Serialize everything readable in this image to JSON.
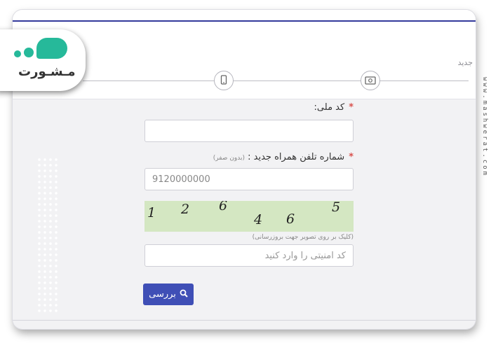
{
  "steps": {
    "label": "جدید",
    "items": [
      {
        "icon": "money-icon"
      },
      {
        "icon": "mobile-phone-icon"
      },
      {
        "icon": "step-circle-partial"
      }
    ]
  },
  "logo": {
    "text": "مـشـورت",
    "accent": "#26b99a"
  },
  "watermark": {
    "text": "www.mashwerat.com"
  },
  "form": {
    "national_code": {
      "label": "کد ملی:",
      "required_mark": "*",
      "value": ""
    },
    "phone": {
      "label": "شماره تلفن همراه جدید :",
      "hint": "(بدون صفر)",
      "required_mark": "*",
      "value": "9120000000"
    },
    "captcha": {
      "digits": [
        "1",
        "2",
        "6",
        "4",
        "6",
        "5"
      ],
      "hint": "(کلیک بر روی تصویر جهت بروزرسانی)"
    },
    "security_code": {
      "placeholder": "کد امنیتی را وارد کنید"
    },
    "submit": {
      "label": "بررسی",
      "icon": "search-icon"
    }
  },
  "colors": {
    "accent_blue": "#3f4fb6",
    "top_line": "#33399b",
    "captcha_bg": "#d4e7c2",
    "required": "#d9534f"
  }
}
